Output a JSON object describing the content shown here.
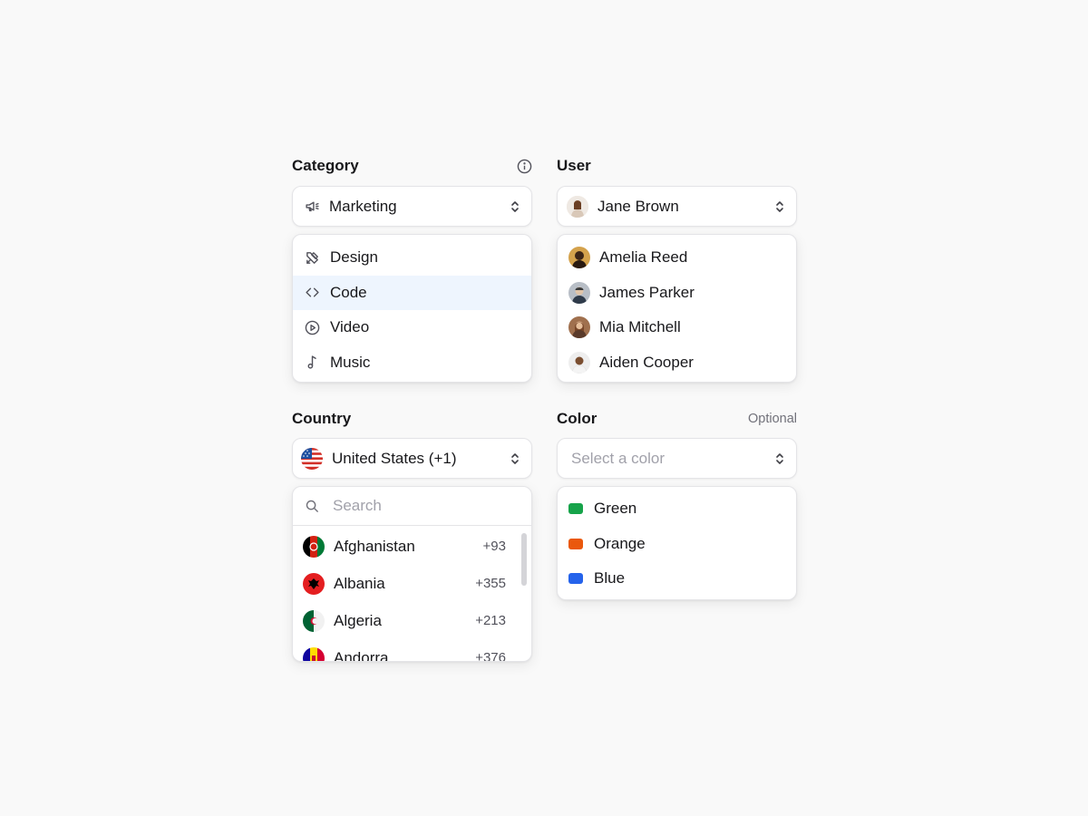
{
  "category": {
    "label": "Category",
    "selected": "Marketing",
    "selected_icon": "megaphone-icon",
    "options": [
      {
        "label": "Design",
        "icon": "design-tools-icon",
        "highlighted": false
      },
      {
        "label": "Code",
        "icon": "code-icon",
        "highlighted": true
      },
      {
        "label": "Video",
        "icon": "play-circle-icon",
        "highlighted": false
      },
      {
        "label": "Music",
        "icon": "music-note-icon",
        "highlighted": false
      }
    ]
  },
  "user": {
    "label": "User",
    "selected": "Jane Brown",
    "options": [
      {
        "label": "Amelia Reed"
      },
      {
        "label": "James Parker"
      },
      {
        "label": "Mia Mitchell"
      },
      {
        "label": "Aiden Cooper"
      }
    ]
  },
  "country": {
    "label": "Country",
    "selected": "United States (+1)",
    "search_placeholder": "Search",
    "options": [
      {
        "name": "Afghanistan",
        "code": "+93"
      },
      {
        "name": "Albania",
        "code": "+355"
      },
      {
        "name": "Algeria",
        "code": "+213"
      },
      {
        "name": "Andorra",
        "code": "+376"
      }
    ]
  },
  "color": {
    "label": "Color",
    "hint": "Optional",
    "placeholder": "Select a color",
    "options": [
      {
        "label": "Green",
        "hex": "#16a34a"
      },
      {
        "label": "Orange",
        "hex": "#ea580c"
      },
      {
        "label": "Blue",
        "hex": "#2563eb"
      }
    ]
  },
  "colors": {
    "highlight_bg": "#eef5fe",
    "border": "#e4e4e7",
    "muted_text": "#71717a",
    "placeholder_text": "#a1a1aa"
  }
}
